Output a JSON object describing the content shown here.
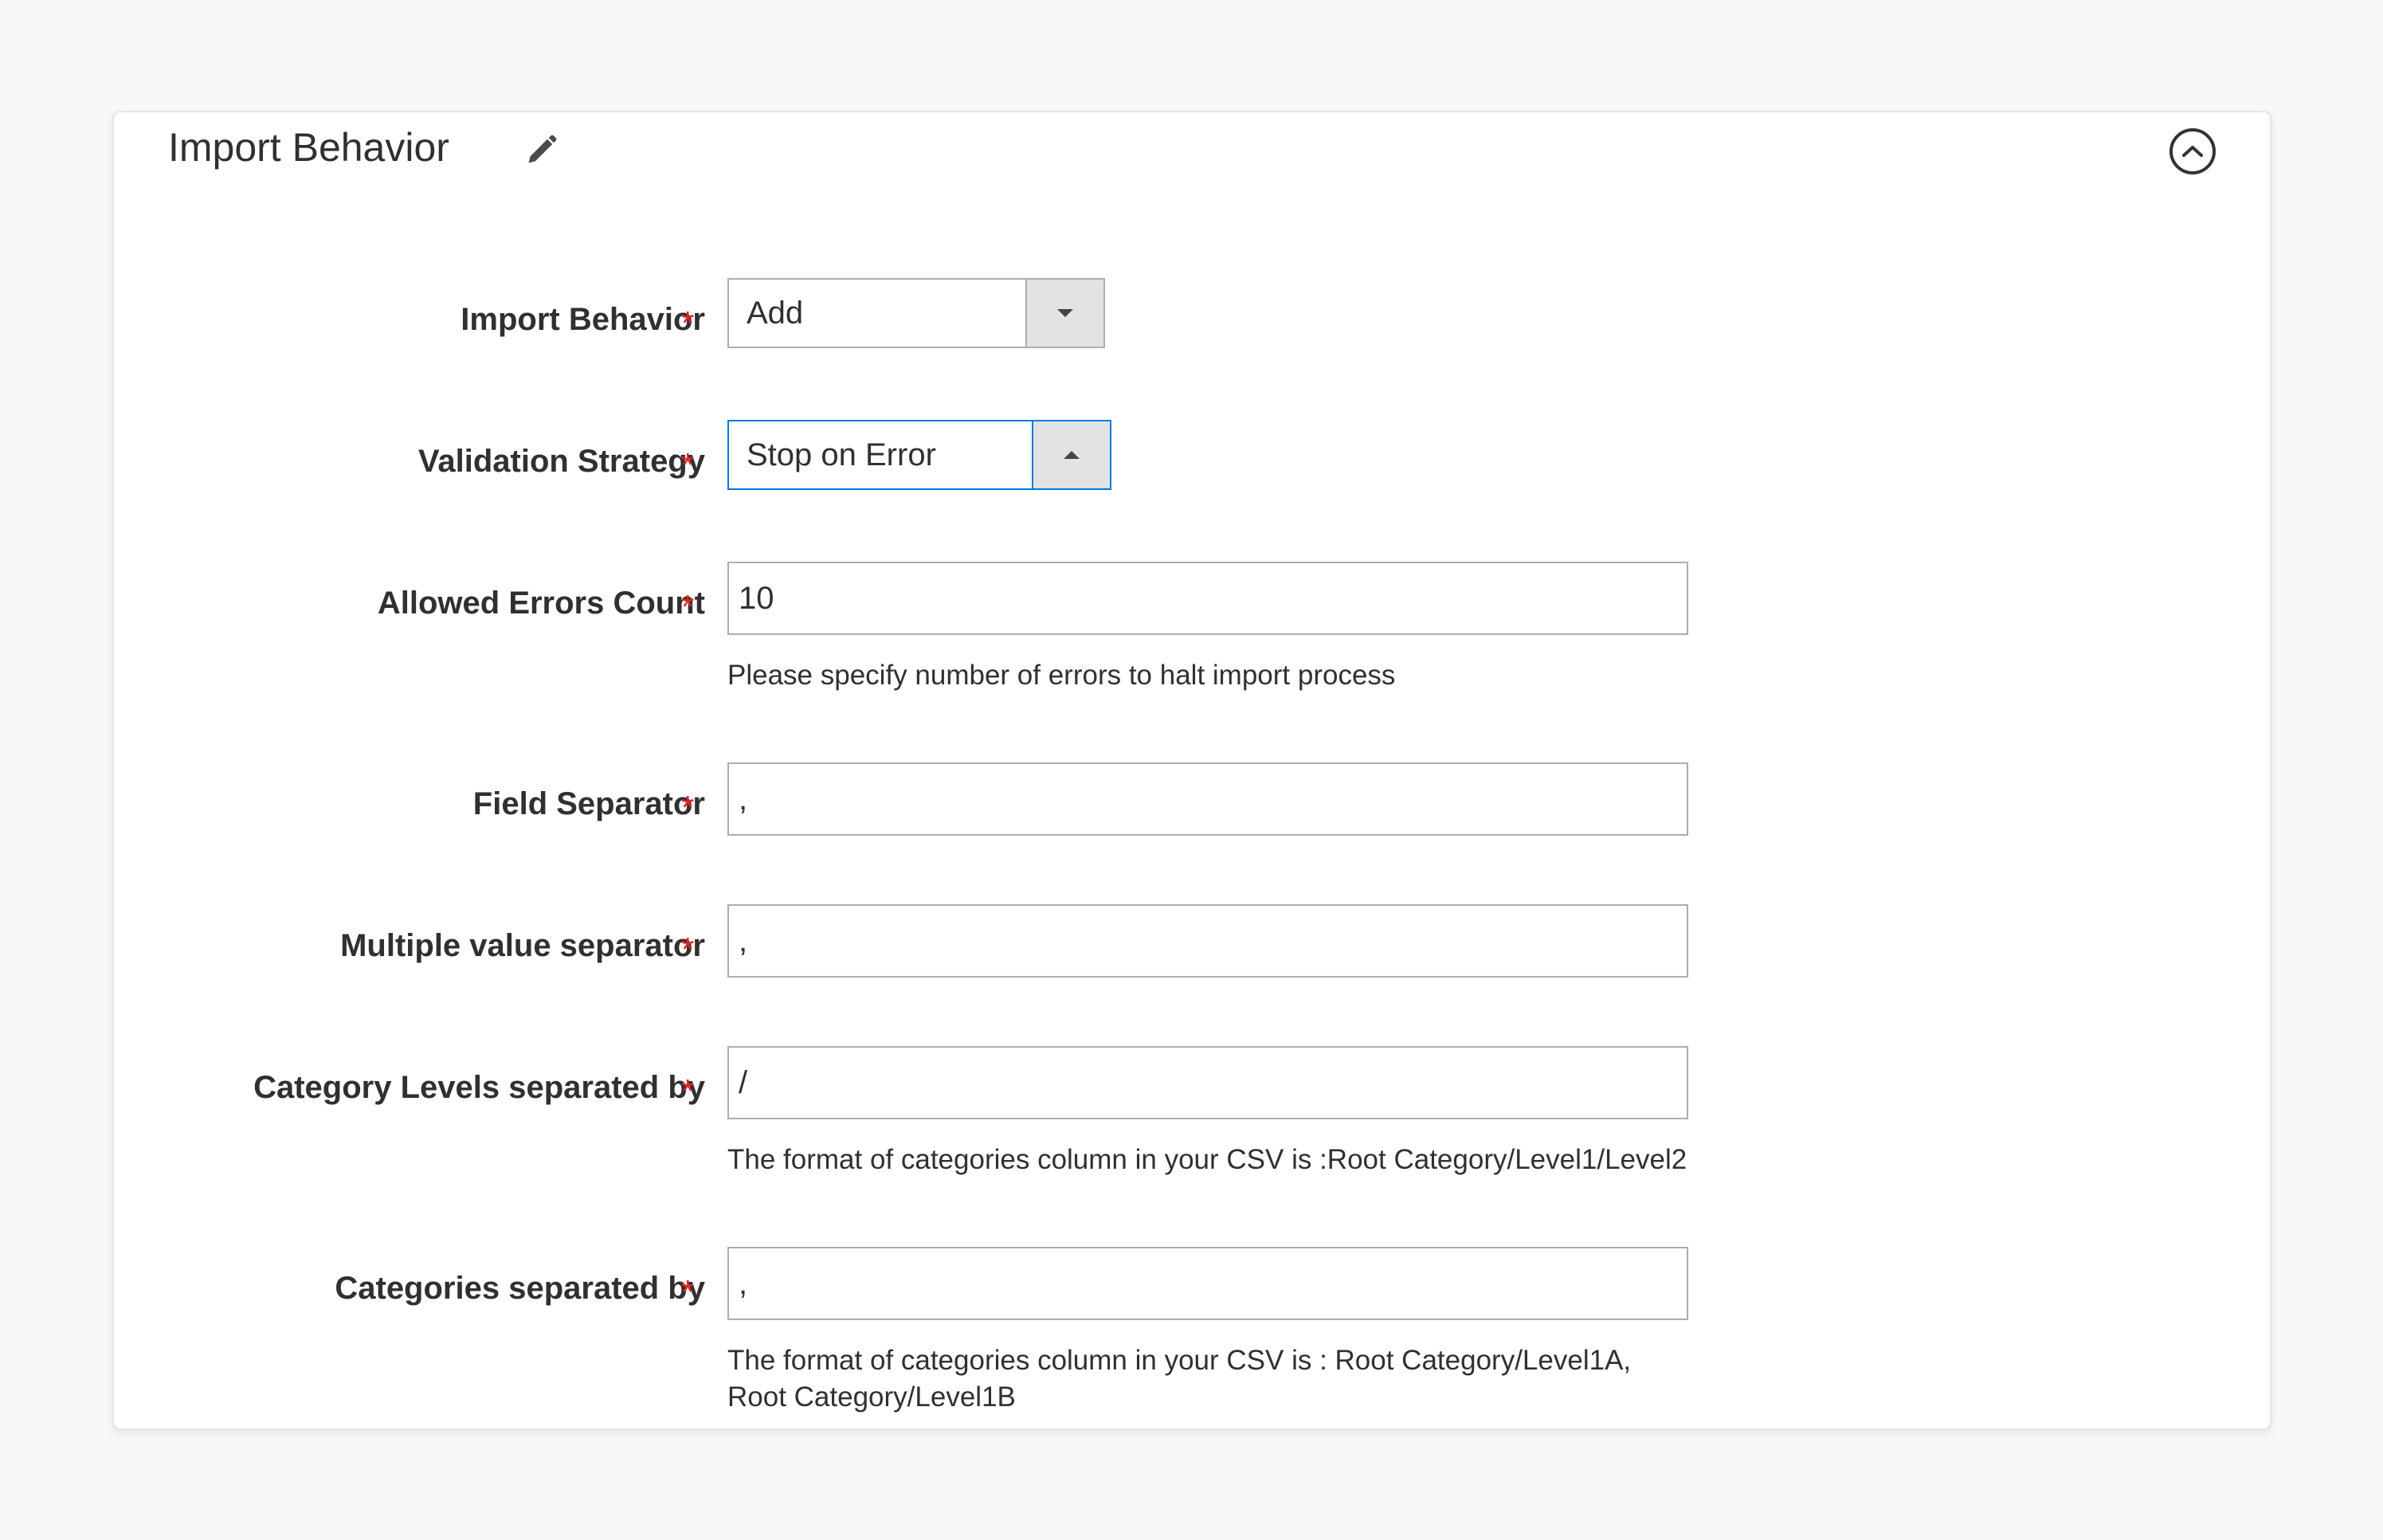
{
  "panel": {
    "title": "Import Behavior"
  },
  "fields": {
    "import_behavior": {
      "label": "Import Behavior",
      "required": "*",
      "value": "Add"
    },
    "validation_strategy": {
      "label": "Validation Strategy",
      "required": "*",
      "value": "Stop on Error"
    },
    "allowed_errors": {
      "label": "Allowed Errors Count",
      "required": "*",
      "value": "10",
      "note": "Please specify number of errors to halt import process"
    },
    "field_separator": {
      "label": "Field Separator",
      "required": "*",
      "value": ","
    },
    "multiple_value_separator": {
      "label": "Multiple value separator",
      "required": "*",
      "value": ","
    },
    "category_levels": {
      "label": "Category Levels separated by",
      "required": "*",
      "value": "/",
      "note": "The format of categories column in your CSV is :Root Category/Level1/Level2"
    },
    "categories_separated": {
      "label": "Categories separated by",
      "required": "*",
      "value": ",",
      "note_line1": "The format of categories column in your CSV is : Root Category/Level1A,",
      "note_line2": "Root Category/Level1B"
    }
  },
  "colors": {
    "required": "#e22626",
    "focus_border": "#007bdb",
    "page_background": "#f8f8f8"
  },
  "icons": {
    "edit": "pencil-icon",
    "collapse": "chevron-up-circle-icon",
    "select_closed": "caret-down-icon",
    "select_open": "caret-up-icon"
  }
}
